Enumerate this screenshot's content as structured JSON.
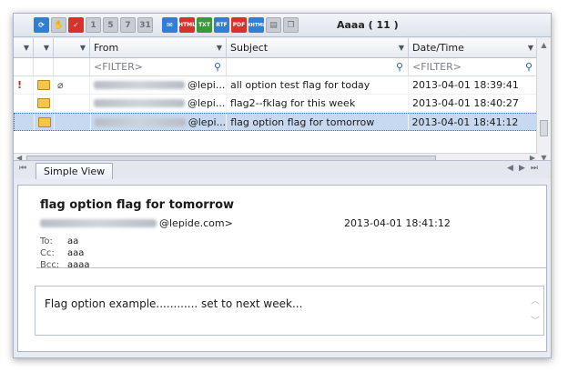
{
  "toolbar": {
    "title": "Aaaa ( 11 )",
    "icons": [
      "refresh-icon",
      "hand-icon",
      "checkmark-icon",
      "calendar-1-icon",
      "calendar-5-icon",
      "calendar-7-icon",
      "calendar-31-icon",
      "mail-icon",
      "html-export-icon",
      "txt-export-icon",
      "rtf-export-icon",
      "pdf-export-icon",
      "xhtml-export-icon",
      "print-icon",
      "copy-icon"
    ],
    "cal_labels": [
      "1",
      "5",
      "7",
      "31"
    ],
    "export_labels": [
      "HTML",
      "TXT",
      "RTF",
      "PDF",
      "XHTML"
    ]
  },
  "grid": {
    "columns": [
      "From",
      "Subject",
      "Date/Time"
    ],
    "filter_placeholder": "<FILTER>",
    "rows": [
      {
        "flag": "!",
        "attach": true,
        "from": "@lepi...",
        "subject": "all option test flag for today",
        "date": "2013-04-01 18:39:41",
        "selected": false
      },
      {
        "flag": "",
        "attach": false,
        "from": "@lepi...",
        "subject": "flag2--fklag for this week",
        "date": "2013-04-01 18:40:27",
        "selected": false
      },
      {
        "flag": "",
        "attach": false,
        "from": "@lepi...",
        "subject": "flag option flag for tomorrow",
        "date": "2013-04-01 18:41:12",
        "selected": true
      }
    ]
  },
  "tab": {
    "label": "Simple View"
  },
  "preview": {
    "subject": "flag option flag for tomorrow",
    "from_suffix": "@lepide.com>",
    "date": "2013-04-01 18:41:12",
    "to_label": "To:",
    "to": "aa",
    "cc_label": "Cc:",
    "cc": "aaa",
    "bcc_label": "Bcc:",
    "bcc": "aaaa",
    "body": "Flag option example............ set to next week..."
  }
}
